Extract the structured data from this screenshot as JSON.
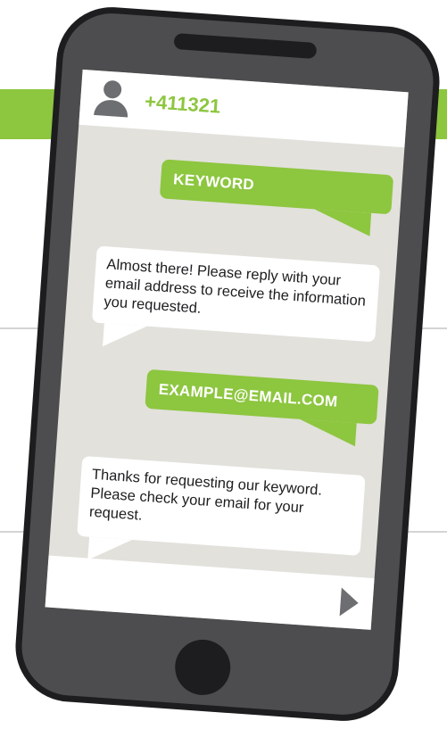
{
  "colors": {
    "accent": "#8dc63f",
    "phone_body": "#4d4d4f",
    "phone_outline": "#1d1d1f",
    "screen_bg": "#e2e1dc",
    "icon_gray": "#6d6e71"
  },
  "header": {
    "contact_number": "+411321",
    "avatar_icon": "person-icon"
  },
  "messages": [
    {
      "direction": "outgoing",
      "text": "KEYWORD"
    },
    {
      "direction": "incoming",
      "text": "Almost there! Please reply with your email address to receive the information you requested."
    },
    {
      "direction": "outgoing",
      "text": "EXAMPLE@EMAIL.COM"
    },
    {
      "direction": "incoming",
      "text": "Thanks for requesting our keyword. Please check your email for your request."
    }
  ],
  "compose": {
    "send_icon": "send-arrow-icon"
  }
}
